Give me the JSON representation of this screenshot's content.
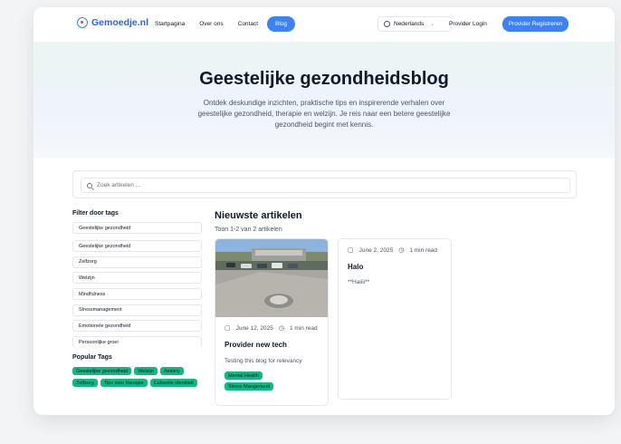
{
  "header": {
    "brand": "Gemoedje.nl",
    "nav": [
      "Startpagina",
      "Over ons",
      "Contact",
      "Blog"
    ],
    "language": "Nederlands",
    "login": "Provider Login",
    "register": "Provider Registreren"
  },
  "hero": {
    "title": "Geestelijke gezondheidsblog",
    "subtitle": "Ontdek deskundige inzichten, praktische tips en inspirerende verhalen over geestelijke gezondheid, therapie en welzijn. Je reis naar een betere geestelijke gezondheid begint met kennis."
  },
  "search": {
    "placeholder": "Zoek artikelen ..."
  },
  "sidebar": {
    "filter_title": "Filter door tags",
    "tags": [
      "Geestelijke gezondheid",
      "Geestelijke gezondheid",
      "Zelfzorg",
      "Welzijn",
      "Mindfulness",
      "Stressmanagement",
      "Emotionele gezondheid",
      "Persoonlijke groei"
    ],
    "popular_title": "Popular Tags",
    "popular_tags": [
      "Geestelijke gezondheid",
      "Welzijn",
      "Anxiety",
      "Zelfzorg",
      "Tips voor therapie",
      "Culturele identiteit"
    ]
  },
  "articles": {
    "title": "Nieuwste artikelen",
    "count": "Toon 1-2 van 2 artikelen",
    "items": [
      {
        "date": "June 12, 2025",
        "read": "1 min read",
        "title": "Provider new tech",
        "excerpt": "Testing this blog for relevancy",
        "tags": [
          "Mental Health",
          "Stress Mangement"
        ]
      },
      {
        "date": "June 2, 2025",
        "read": "1 min read",
        "title": "Halo",
        "excerpt": "**Haiiii**",
        "tags": []
      }
    ]
  },
  "colors": {
    "accent": "#3b82f6",
    "chip": "#10b981",
    "brand": "#2563eb"
  }
}
